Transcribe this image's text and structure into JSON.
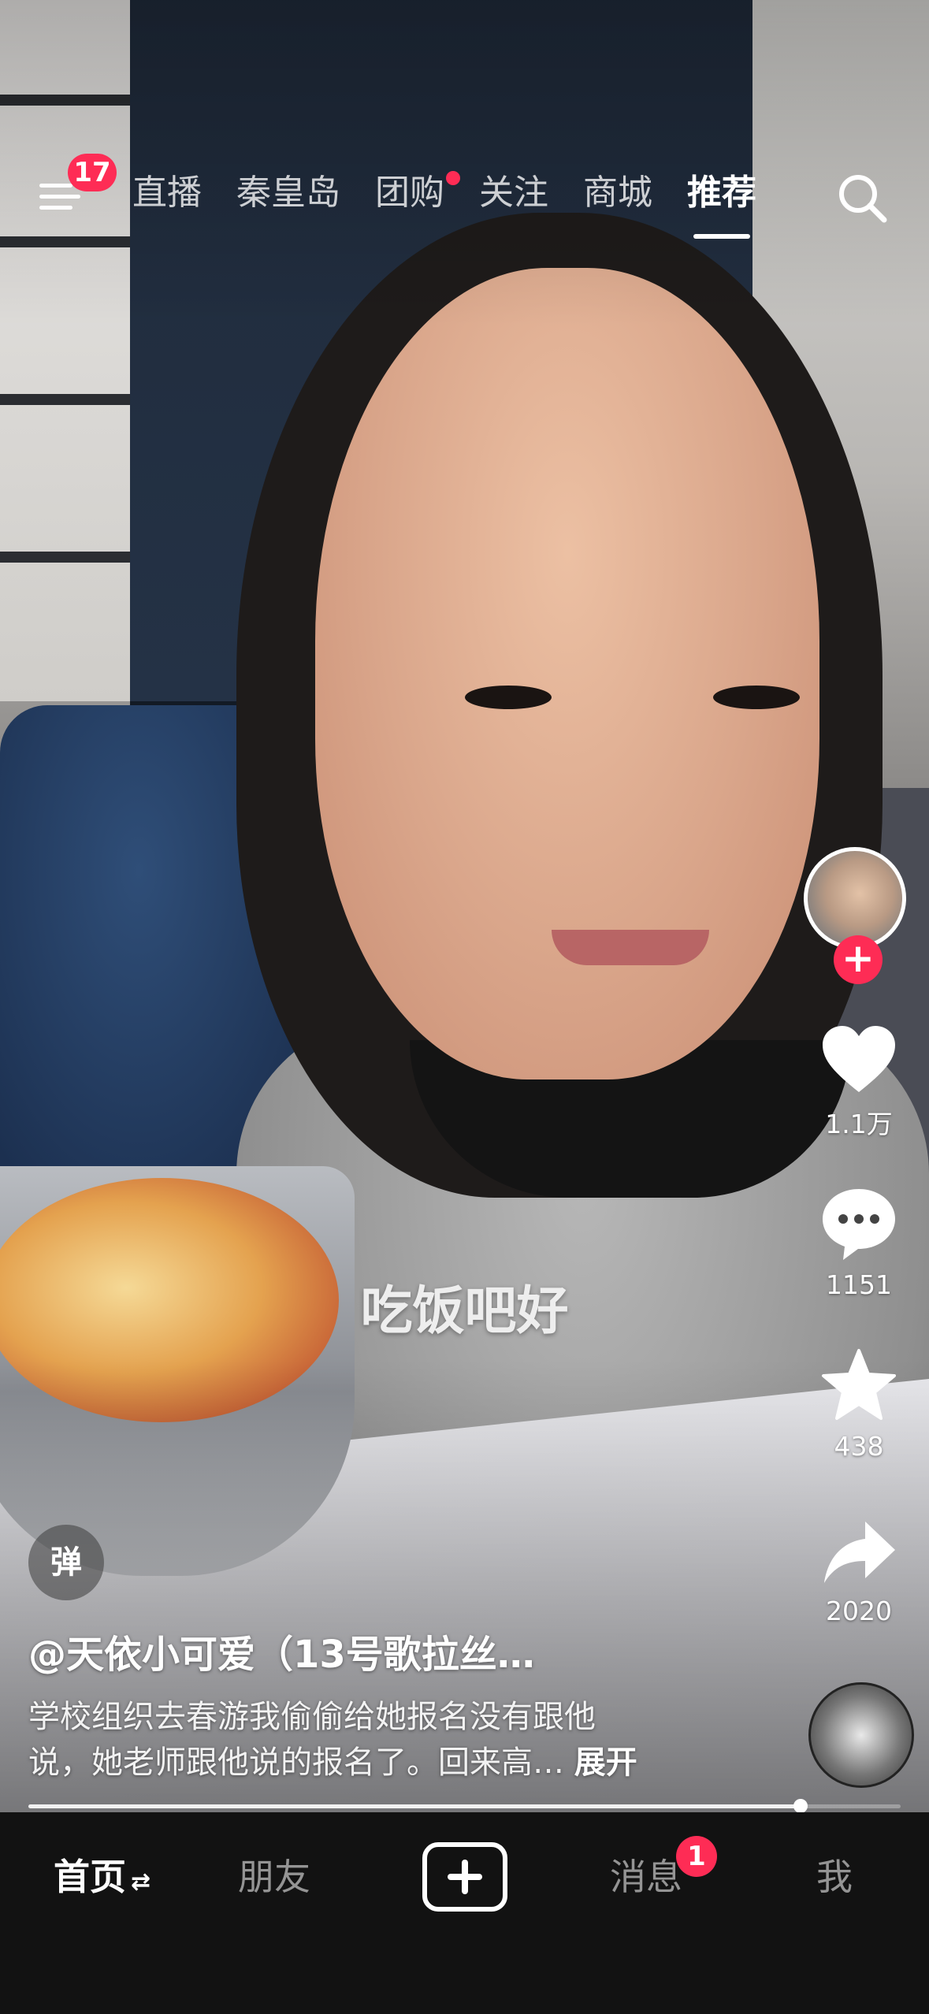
{
  "top_nav": {
    "menu_badge": "17",
    "tabs": [
      {
        "label": "直播"
      },
      {
        "label": "秦皇岛"
      },
      {
        "label": "团购"
      },
      {
        "label": "关注"
      },
      {
        "label": "商城"
      },
      {
        "label": "推荐"
      }
    ],
    "active_tab": "推荐",
    "dot_tab": "团购"
  },
  "video": {
    "subtitle": "吃饭吧好",
    "danmu_label": "弹",
    "author": "@天依小可爱（13号歌拉丝…",
    "description_line1": "学校组织去春游我偷偷给她报名没有跟他",
    "description_line2": "说，她老师跟他说的报名了。回来高…",
    "expand_label": "展开",
    "progress": 0.885
  },
  "actions": {
    "likes": "1.1万",
    "comments": "1151",
    "favorites": "438",
    "shares": "2020"
  },
  "bottom_nav": {
    "home": "首页",
    "home_swap": "⇄",
    "friends": "朋友",
    "create": "+",
    "messages": "消息",
    "messages_badge": "1",
    "me": "我"
  },
  "colors": {
    "accent": "#fe2c55",
    "nav_bg": "#121212"
  }
}
